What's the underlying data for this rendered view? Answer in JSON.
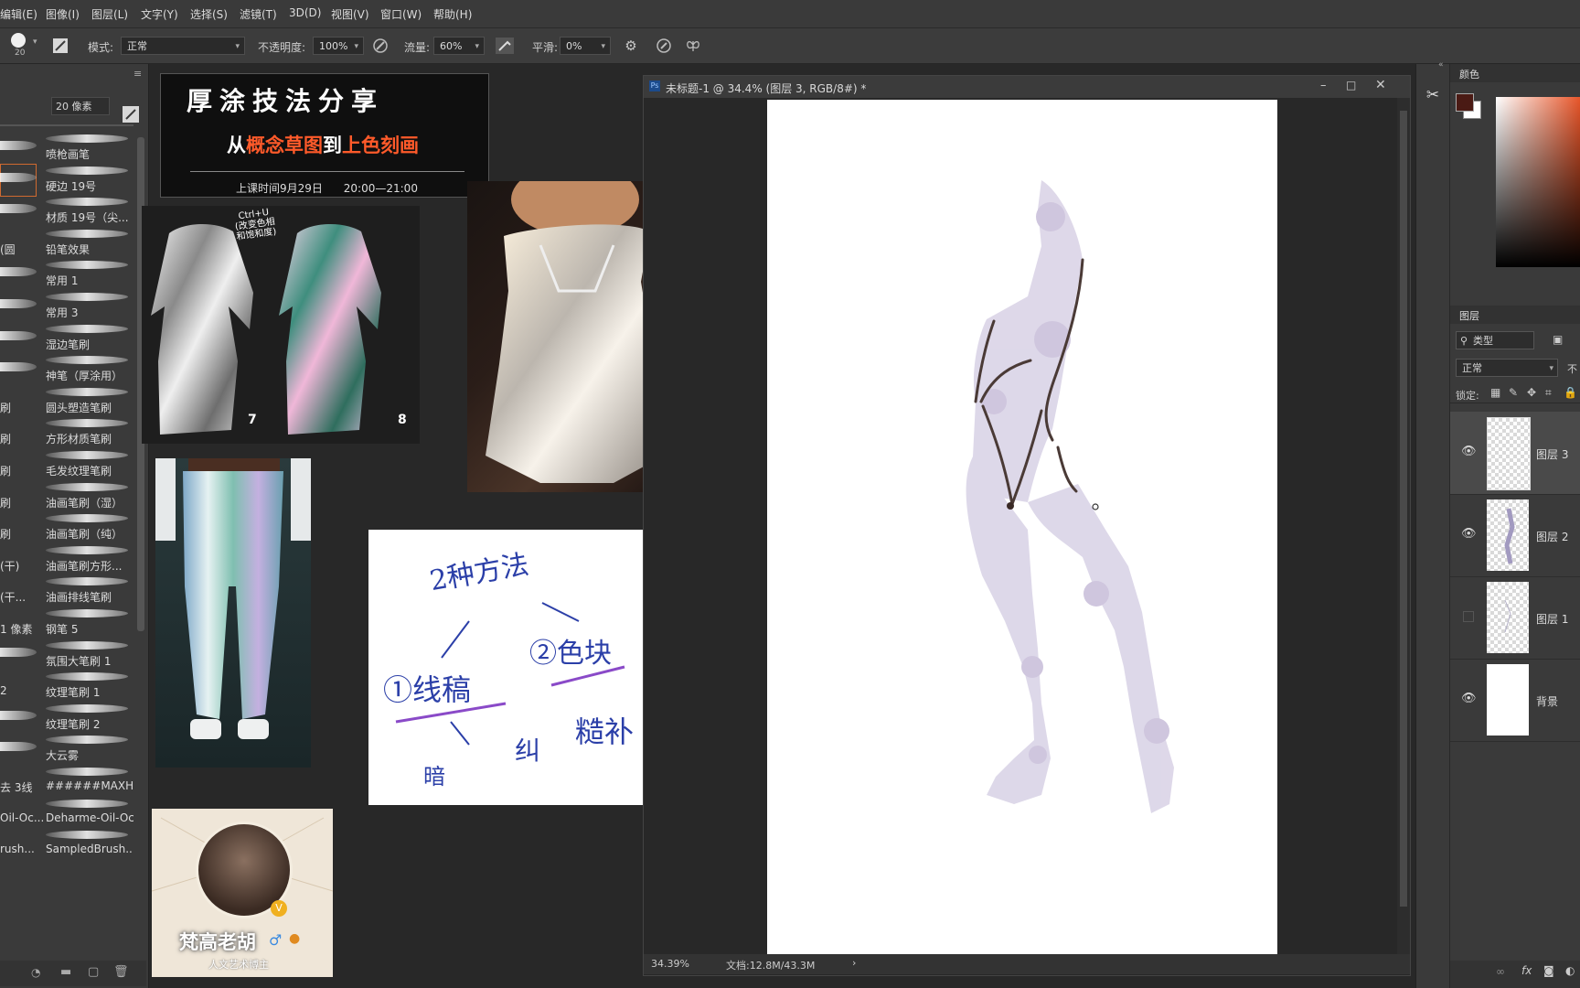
{
  "menu": [
    "编辑(E)",
    "图像(I)",
    "图层(L)",
    "文字(Y)",
    "选择(S)",
    "滤镜(T)",
    "3D(D)",
    "视图(V)",
    "窗口(W)",
    "帮助(H)"
  ],
  "options": {
    "brush_size": "20",
    "mode_label": "模式:",
    "mode_value": "正常",
    "opacity_label": "不透明度:",
    "opacity_value": "100%",
    "flow_label": "流量:",
    "flow_value": "60%",
    "smooth_label": "平滑:",
    "smooth_value": "0%"
  },
  "brush_panel": {
    "size_label": "20 像素",
    "left_labels": [
      "(圆",
      "刷",
      "刷",
      "刷",
      "刷",
      "刷",
      "(干)",
      "(干...",
      "1 像素",
      "2",
      "去 3线",
      "Oil-Oc...",
      "rush..."
    ],
    "brushes": [
      "喷枪画笔",
      "硬边 19号",
      "材质 19号（尖...",
      "铅笔效果",
      "常用 1",
      "常用 3",
      "湿边笔刷",
      "神笔（厚涂用）",
      "圆头塑造笔刷",
      "方形材质笔刷",
      "毛发纹理笔刷",
      "油画笔刷（湿）",
      "油画笔刷（纯）",
      "油画笔刷方形...",
      "油画排线笔刷",
      "钢笔 5",
      "氛围大笔刷 1",
      "纹理笔刷 1",
      "纹理笔刷 2",
      "大云雾",
      "######MAXH...",
      "Deharme-Oil-Oc...",
      "SampledBrush..."
    ]
  },
  "banner": {
    "title": "厚涂技法分享",
    "subtitle_white1": "从",
    "subtitle_orange1": "概念草图",
    "subtitle_white2": "到",
    "subtitle_orange2": "上色刻画",
    "time": "上课时间9月29日      20:00—21:00"
  },
  "jacket_ref": {
    "note_line1": "Ctrl+U",
    "note_line2": "(改变色相",
    "note_line3": "和饱和度)",
    "num_left": "7",
    "num_right": "8"
  },
  "sketch_note": {
    "line1": "2种方法",
    "item1": "①线稿",
    "item2": "②色块",
    "sub1": "暗",
    "sub2": "纠",
    "sub3": "糙补"
  },
  "profile": {
    "name": "梵高老胡",
    "subtitle": "人文艺术博主",
    "badge": "V"
  },
  "document": {
    "title": "未标题-1 @ 34.4% (图层 3, RGB/8#) *",
    "zoom": "34.39%",
    "doc_size": "文档:12.8M/43.3M"
  },
  "color_panel": {
    "tab": "颜色",
    "fg_color": "#4a1a14",
    "bg_color": "#ffffff"
  },
  "layers_panel": {
    "tab": "图层",
    "filter_value": "类型",
    "blend_mode": "正常",
    "opacity_short": "不",
    "lock_label": "锁定:",
    "layers": [
      {
        "name": "图层 3",
        "visible": true
      },
      {
        "name": "图层 2",
        "visible": true
      },
      {
        "name": "图层 1",
        "visible": false
      },
      {
        "name": "背景",
        "visible": true
      }
    ]
  },
  "colors": {
    "ui_bg": "#282828",
    "panel": "#3a3a3a",
    "accent_orange": "#ff6a2a",
    "figure_fill": "#d9d4e6",
    "figure_line": "#4a3a36"
  }
}
